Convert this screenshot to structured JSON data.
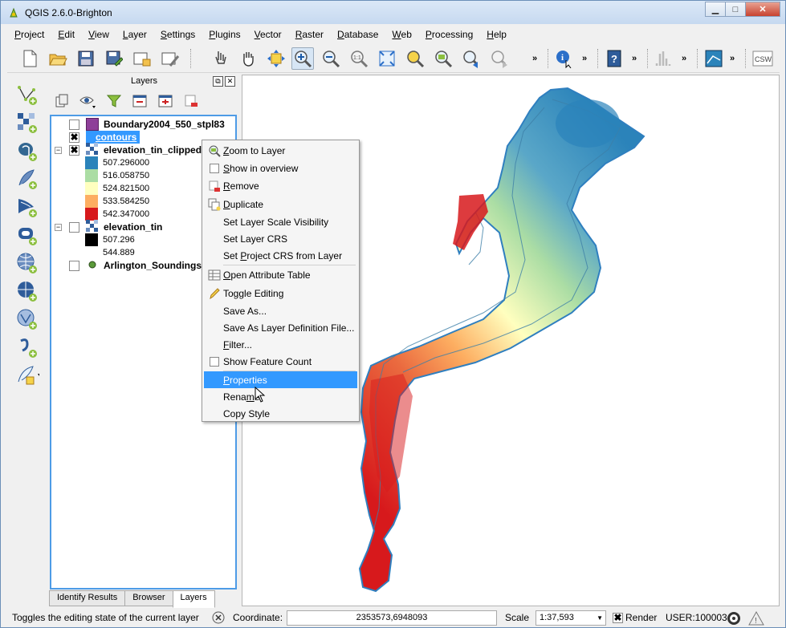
{
  "window": {
    "title": "QGIS 2.6.0-Brighton",
    "controls": {
      "minimize": "▁",
      "maximize": "□",
      "close": "✕"
    }
  },
  "menubar": {
    "items": [
      {
        "first": "P",
        "rest": "roject"
      },
      {
        "first": "E",
        "rest": "dit"
      },
      {
        "first": "V",
        "rest": "iew"
      },
      {
        "first": "L",
        "rest": "ayer"
      },
      {
        "first": "S",
        "rest": "ettings"
      },
      {
        "first": "P",
        "rest": "lugins"
      },
      {
        "first": "V",
        "rest": "ector"
      },
      {
        "first": "R",
        "rest": "aster"
      },
      {
        "first": "D",
        "rest": "atabase"
      },
      {
        "first": "W",
        "rest": "eb"
      },
      {
        "first": "P",
        "rest": "rocessing"
      },
      {
        "first": "H",
        "rest": "elp"
      }
    ]
  },
  "toolbar": {
    "more_glyph": "»",
    "csw_label": "CSW"
  },
  "layers_panel": {
    "title": "Layers",
    "float_glyph": "⧉",
    "close_glyph": "✕",
    "layers": [
      {
        "name": "Boundary2004_550_stpl83",
        "checked": false,
        "color": "#8e3f99"
      },
      {
        "name": "contours",
        "checked": true,
        "selected": true
      },
      {
        "name": "elevation_tin_clipped",
        "checked": true,
        "expanded": true,
        "legend": [
          {
            "label": "507.296000",
            "color": "#2b83ba"
          },
          {
            "label": "516.058750",
            "color": "#abdda4"
          },
          {
            "label": "524.821500",
            "color": "#ffffbf"
          },
          {
            "label": "533.584250",
            "color": "#fdae61"
          },
          {
            "label": "542.347000",
            "color": "#d7191c"
          }
        ]
      },
      {
        "name": "elevation_tin",
        "checked": false,
        "expanded": true,
        "legend": [
          {
            "label": "507.296",
            "color": "#000000"
          },
          {
            "label": "544.889",
            "color": "#ffffff"
          }
        ]
      },
      {
        "name": "Arlington_Soundings_",
        "checked": false,
        "color": "#5b9a3a"
      }
    ],
    "check_glyph": "✖",
    "expand_glyph": "−",
    "tabs": [
      "Identify Results",
      "Browser",
      "Layers"
    ],
    "active_tab": "Layers"
  },
  "context_menu": {
    "items": [
      {
        "pre": "",
        "u": "Z",
        "post": "oom to Layer",
        "icon": "zoom-to-layer-icon"
      },
      {
        "pre": "",
        "u": "S",
        "post": "how in overview",
        "icon": "checkbox"
      },
      {
        "pre": "",
        "u": "R",
        "post": "emove",
        "icon": "remove-layer-icon"
      },
      {
        "pre": "",
        "u": "D",
        "post": "uplicate",
        "icon": "duplicate-icon"
      },
      {
        "pre": "Set Layer Scale Visibility",
        "u": "",
        "post": "",
        "icon": ""
      },
      {
        "pre": "Set Layer CRS",
        "u": "",
        "post": "",
        "icon": ""
      },
      {
        "pre": "Set ",
        "u": "P",
        "post": "roject CRS from Layer",
        "icon": ""
      },
      {
        "pre": "",
        "u": "O",
        "post": "pen Attribute Table",
        "icon": "table-icon"
      },
      {
        "pre": "Toggle Editing",
        "u": "",
        "post": "",
        "icon": "pencil-icon"
      },
      {
        "pre": "Save As...",
        "u": "",
        "post": "",
        "icon": ""
      },
      {
        "pre": "Save As Layer Definition File...",
        "u": "",
        "post": "",
        "icon": ""
      },
      {
        "pre": "",
        "u": "F",
        "post": "ilter...",
        "icon": ""
      },
      {
        "pre": "Show Feature Count",
        "u": "",
        "post": "",
        "icon": "checkbox"
      },
      {
        "pre": "",
        "u": "P",
        "post": "roperties",
        "icon": "",
        "highlighted": true
      },
      {
        "pre": "Rena",
        "u": "m",
        "post": "e",
        "icon": ""
      },
      {
        "pre": "Copy Style",
        "u": "",
        "post": "",
        "icon": ""
      }
    ]
  },
  "statusbar": {
    "message": "Toggles the editing state of the current layer",
    "coordinate_label": "Coordinate:",
    "coordinate_value": "2353573,6948093",
    "scale_label": "Scale",
    "scale_value": "1:37,593",
    "render_label": "Render",
    "render_checked": "✖",
    "crs_label": "USER:100003",
    "dropdown_glyph": "▼"
  }
}
